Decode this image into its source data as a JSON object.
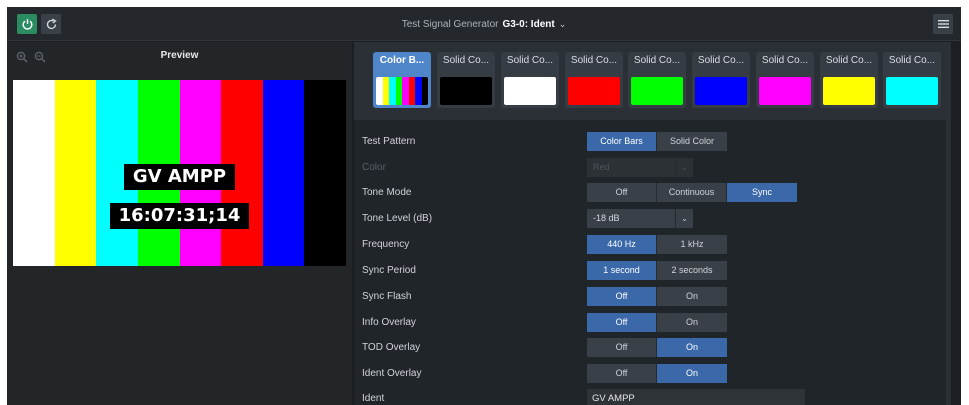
{
  "header": {
    "title_prefix": "Test Signal Generator",
    "instance": "G3-0: Ident",
    "caret": "⌄",
    "colors": {
      "power": "#2a8c60",
      "accent": "#3a68a8"
    }
  },
  "preview": {
    "title": "Preview",
    "bars": [
      "#ffffff",
      "#ffff00",
      "#00ffff",
      "#00ff00",
      "#ff00ff",
      "#ff0000",
      "#0000ff",
      "#000000"
    ],
    "ident_text": "GV AMPP",
    "tod_text": "16:07:31;14"
  },
  "presets": [
    {
      "label": "Color B...",
      "type": "bars",
      "active": true
    },
    {
      "label": "Solid Co...",
      "color": "#000000"
    },
    {
      "label": "Solid Co...",
      "color": "#ffffff"
    },
    {
      "label": "Solid Co...",
      "color": "#ff0000"
    },
    {
      "label": "Solid Co...",
      "color": "#00ff00"
    },
    {
      "label": "Solid Co...",
      "color": "#0000ff"
    },
    {
      "label": "Solid Co...",
      "color": "#ff00ff"
    },
    {
      "label": "Solid Co...",
      "color": "#ffff00"
    },
    {
      "label": "Solid Co...",
      "color": "#00ffff"
    }
  ],
  "props": {
    "test_pattern": {
      "label": "Test Pattern",
      "options": [
        "Color Bars",
        "Solid Color"
      ],
      "selected": 0
    },
    "color": {
      "label": "Color",
      "value": "Red",
      "arrow": "⌄"
    },
    "tone_mode": {
      "label": "Tone Mode",
      "options": [
        "Off",
        "Continuous",
        "Sync"
      ],
      "selected": 2
    },
    "tone_level": {
      "label": "Tone Level (dB)",
      "value": "-18 dB",
      "arrow": "⌄"
    },
    "frequency": {
      "label": "Frequency",
      "options": [
        "440 Hz",
        "1 kHz"
      ],
      "selected": 0
    },
    "sync_period": {
      "label": "Sync Period",
      "options": [
        "1 second",
        "2 seconds"
      ],
      "selected": 0
    },
    "sync_flash": {
      "label": "Sync Flash",
      "options": [
        "Off",
        "On"
      ],
      "selected": 0
    },
    "info_overlay": {
      "label": "Info Overlay",
      "options": [
        "Off",
        "On"
      ],
      "selected": 0
    },
    "tod_overlay": {
      "label": "TOD Overlay",
      "options": [
        "Off",
        "On"
      ],
      "selected": 1
    },
    "ident_overlay": {
      "label": "Ident Overlay",
      "options": [
        "Off",
        "On"
      ],
      "selected": 1
    },
    "ident": {
      "label": "Ident",
      "value": "GV AMPP"
    }
  }
}
